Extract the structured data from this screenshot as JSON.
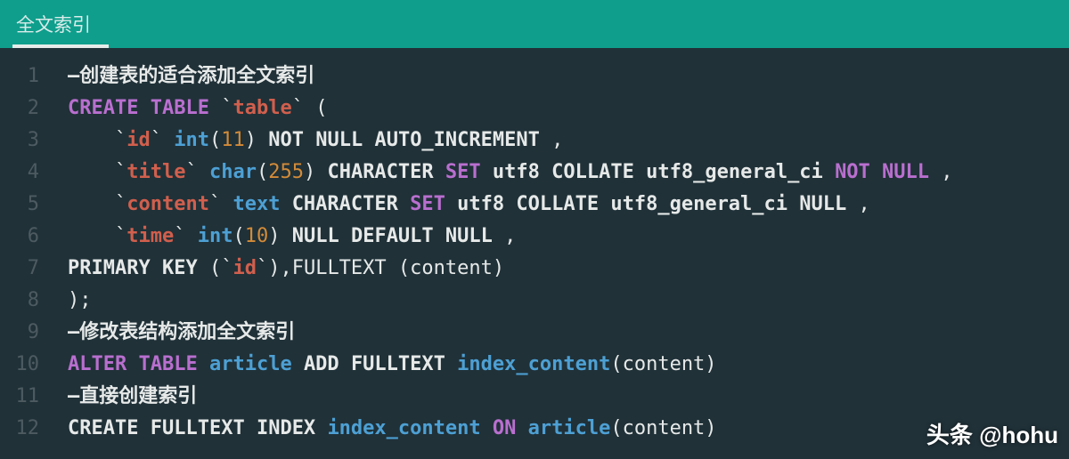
{
  "tab": {
    "title": "全文索引",
    "active": true
  },
  "gutter": {
    "start": 1,
    "end": 12
  },
  "code": {
    "lines": [
      [
        {
          "cls": "tk-comment",
          "t": "–创建表的适合添加全文索引"
        }
      ],
      [
        {
          "cls": "tk-kw",
          "t": "CREATE"
        },
        {
          "cls": "tk-punc",
          "t": " "
        },
        {
          "cls": "tk-kw",
          "t": "TABLE"
        },
        {
          "cls": "tk-punc",
          "t": " `"
        },
        {
          "cls": "tk-ident",
          "t": "table"
        },
        {
          "cls": "tk-punc",
          "t": "` ("
        }
      ],
      [
        {
          "cls": "tk-punc",
          "t": "    `"
        },
        {
          "cls": "tk-ident",
          "t": "id"
        },
        {
          "cls": "tk-punc",
          "t": "` "
        },
        {
          "cls": "tk-type",
          "t": "int"
        },
        {
          "cls": "tk-punc",
          "t": "("
        },
        {
          "cls": "tk-num",
          "t": "11"
        },
        {
          "cls": "tk-punc",
          "t": ") "
        },
        {
          "cls": "tk-kw2",
          "t": "NOT NULL"
        },
        {
          "cls": "tk-punc",
          "t": " "
        },
        {
          "cls": "tk-kw2",
          "t": "AUTO_INCREMENT"
        },
        {
          "cls": "tk-punc",
          "t": " ,"
        }
      ],
      [
        {
          "cls": "tk-punc",
          "t": "    `"
        },
        {
          "cls": "tk-ident",
          "t": "title"
        },
        {
          "cls": "tk-punc",
          "t": "` "
        },
        {
          "cls": "tk-type",
          "t": "char"
        },
        {
          "cls": "tk-punc",
          "t": "("
        },
        {
          "cls": "tk-num",
          "t": "255"
        },
        {
          "cls": "tk-punc",
          "t": ") "
        },
        {
          "cls": "tk-kw2",
          "t": "CHARACTER"
        },
        {
          "cls": "tk-punc",
          "t": " "
        },
        {
          "cls": "tk-kw",
          "t": "SET"
        },
        {
          "cls": "tk-punc",
          "t": " "
        },
        {
          "cls": "tk-txt",
          "t": "utf8"
        },
        {
          "cls": "tk-punc",
          "t": " "
        },
        {
          "cls": "tk-kw2",
          "t": "COLLATE"
        },
        {
          "cls": "tk-punc",
          "t": " "
        },
        {
          "cls": "tk-txt",
          "t": "utf8_general_ci"
        },
        {
          "cls": "tk-punc",
          "t": " "
        },
        {
          "cls": "tk-kw",
          "t": "NOT NULL"
        },
        {
          "cls": "tk-punc",
          "t": " ,"
        }
      ],
      [
        {
          "cls": "tk-punc",
          "t": "    `"
        },
        {
          "cls": "tk-ident",
          "t": "content"
        },
        {
          "cls": "tk-punc",
          "t": "` "
        },
        {
          "cls": "tk-type",
          "t": "text"
        },
        {
          "cls": "tk-punc",
          "t": " "
        },
        {
          "cls": "tk-kw2",
          "t": "CHARACTER"
        },
        {
          "cls": "tk-punc",
          "t": " "
        },
        {
          "cls": "tk-kw",
          "t": "SET"
        },
        {
          "cls": "tk-punc",
          "t": " "
        },
        {
          "cls": "tk-txt",
          "t": "utf8"
        },
        {
          "cls": "tk-punc",
          "t": " "
        },
        {
          "cls": "tk-kw2",
          "t": "COLLATE"
        },
        {
          "cls": "tk-punc",
          "t": " "
        },
        {
          "cls": "tk-txt",
          "t": "utf8_general_ci"
        },
        {
          "cls": "tk-punc",
          "t": " "
        },
        {
          "cls": "tk-kw2",
          "t": "NULL"
        },
        {
          "cls": "tk-punc",
          "t": " ,"
        }
      ],
      [
        {
          "cls": "tk-punc",
          "t": "    `"
        },
        {
          "cls": "tk-ident",
          "t": "time"
        },
        {
          "cls": "tk-punc",
          "t": "` "
        },
        {
          "cls": "tk-type",
          "t": "int"
        },
        {
          "cls": "tk-punc",
          "t": "("
        },
        {
          "cls": "tk-num",
          "t": "10"
        },
        {
          "cls": "tk-punc",
          "t": ") "
        },
        {
          "cls": "tk-kw2",
          "t": "NULL"
        },
        {
          "cls": "tk-punc",
          "t": " "
        },
        {
          "cls": "tk-kw2",
          "t": "DEFAULT NULL"
        },
        {
          "cls": "tk-punc",
          "t": " ,"
        }
      ],
      [
        {
          "cls": "tk-kw2",
          "t": "PRIMARY"
        },
        {
          "cls": "tk-punc",
          "t": " "
        },
        {
          "cls": "tk-kw2",
          "t": "KEY"
        },
        {
          "cls": "tk-punc",
          "t": " (`"
        },
        {
          "cls": "tk-ident",
          "t": "id"
        },
        {
          "cls": "tk-punc",
          "t": "`),FULLTEXT (content)"
        }
      ],
      [
        {
          "cls": "tk-punc",
          "t": ");"
        }
      ],
      [
        {
          "cls": "tk-comment",
          "t": "–修改表结构添加全文索引"
        }
      ],
      [
        {
          "cls": "tk-kw",
          "t": "ALTER"
        },
        {
          "cls": "tk-punc",
          "t": " "
        },
        {
          "cls": "tk-kw",
          "t": "TABLE"
        },
        {
          "cls": "tk-punc",
          "t": " "
        },
        {
          "cls": "tk-type",
          "t": "article"
        },
        {
          "cls": "tk-punc",
          "t": " "
        },
        {
          "cls": "tk-kw2",
          "t": "ADD"
        },
        {
          "cls": "tk-punc",
          "t": " "
        },
        {
          "cls": "tk-kw2",
          "t": "FULLTEXT"
        },
        {
          "cls": "tk-punc",
          "t": " "
        },
        {
          "cls": "tk-type",
          "t": "index_content"
        },
        {
          "cls": "tk-punc",
          "t": "(content)"
        }
      ],
      [
        {
          "cls": "tk-comment",
          "t": "–直接创建索引"
        }
      ],
      [
        {
          "cls": "tk-kw2",
          "t": "CREATE"
        },
        {
          "cls": "tk-punc",
          "t": " "
        },
        {
          "cls": "tk-kw2",
          "t": "FULLTEXT"
        },
        {
          "cls": "tk-punc",
          "t": " "
        },
        {
          "cls": "tk-kw2",
          "t": "INDEX"
        },
        {
          "cls": "tk-punc",
          "t": " "
        },
        {
          "cls": "tk-type",
          "t": "index_content"
        },
        {
          "cls": "tk-punc",
          "t": " "
        },
        {
          "cls": "tk-kw",
          "t": "ON"
        },
        {
          "cls": "tk-punc",
          "t": " "
        },
        {
          "cls": "tk-type",
          "t": "article"
        },
        {
          "cls": "tk-punc",
          "t": "(content)"
        }
      ]
    ]
  },
  "watermark": "头条 @hohu"
}
